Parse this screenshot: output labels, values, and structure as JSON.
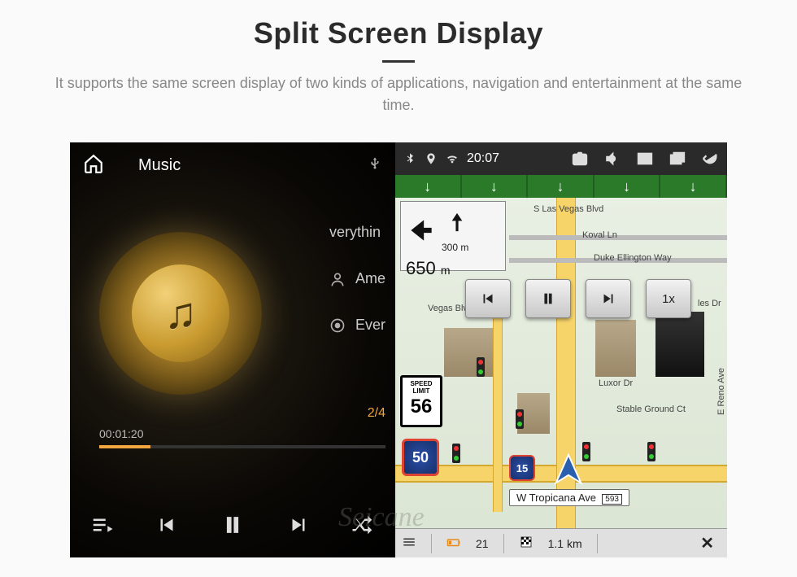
{
  "header": {
    "title": "Split Screen Display",
    "subtitle": "It supports the same screen display of two kinds of applications, navigation and entertainment at the same time."
  },
  "music": {
    "tab_label": "Music",
    "track_title": "verythin",
    "artist": "Ame",
    "repeat": "Ever",
    "counter": "2/4",
    "elapsed": "00:01:20"
  },
  "status": {
    "time": "20:07"
  },
  "nav": {
    "turn_dist_small": "300",
    "turn_dist_small_unit": "m",
    "turn_dist_big": "650",
    "turn_dist_big_unit": "m",
    "speed_label_1": "SPEED",
    "speed_label_2": "LIMIT",
    "speed_value": "56",
    "route_shield": "50",
    "interstate": "15",
    "road_main": "W Tropicana Ave",
    "road_main_num": "593",
    "speed_1x": "1x",
    "streets": {
      "s_las_vegas": "S Las Vegas Blvd",
      "koval": "Koval Ln",
      "duke": "Duke Ellington Way",
      "vegas_blvd": "Vegas Blvd",
      "luxor": "Luxor Dr",
      "stable": "Stable Ground Ct",
      "reno": "E Reno Ave",
      "les": "les Dr"
    },
    "bottom": {
      "pct": "21",
      "km": "1.1",
      "km_unit": "km"
    }
  },
  "watermark": "Seicane"
}
